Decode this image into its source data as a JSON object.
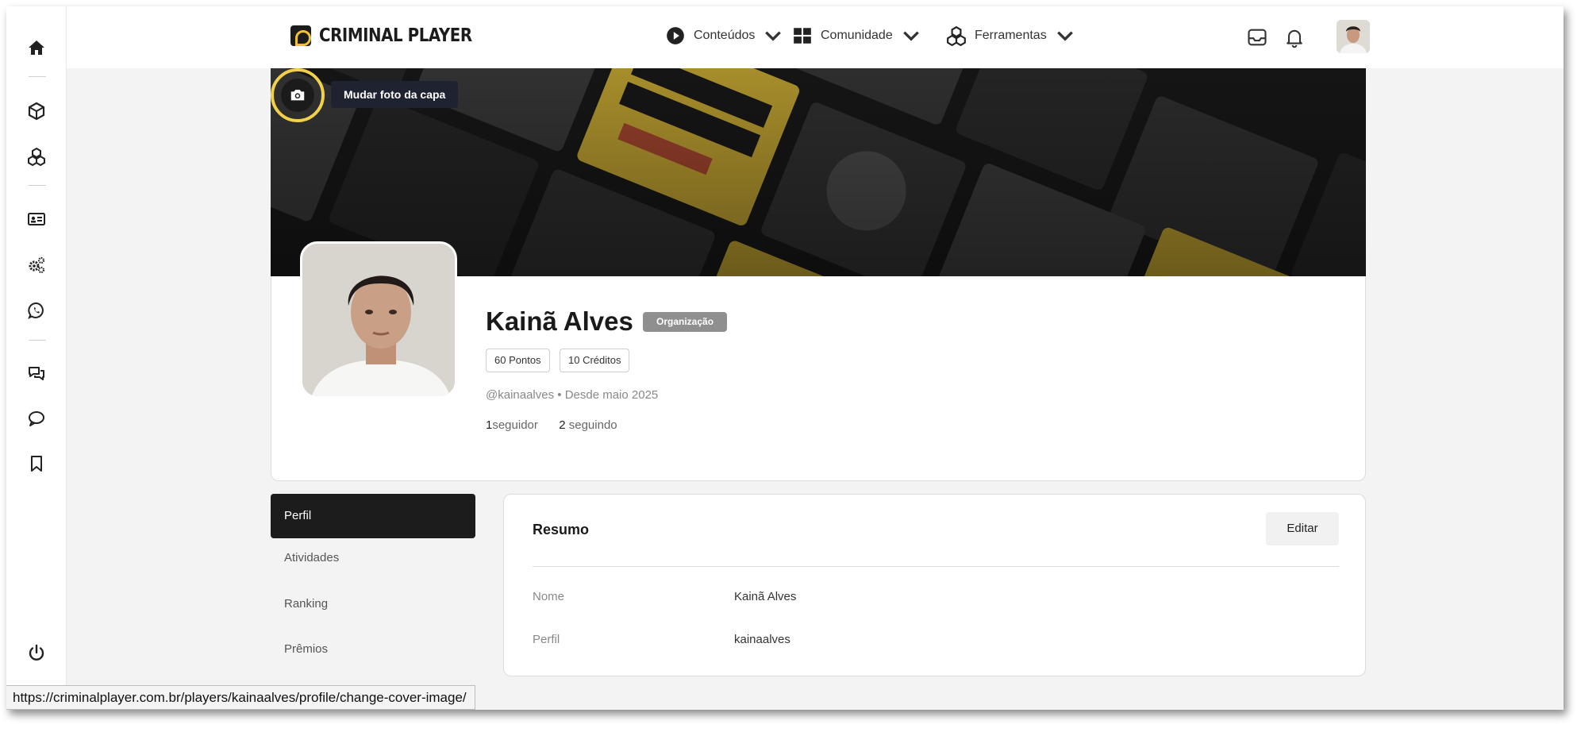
{
  "brand": {
    "name": "CRIMINAL PLAYER",
    "accent": "#f2c230",
    "dark": "#1c1c1c"
  },
  "sidebar": {
    "icons": [
      "home-icon",
      "cube-icon",
      "cubes-icon",
      "id-card-icon",
      "gears-icon",
      "whatsapp-icon",
      "comments-icon",
      "comment-icon",
      "bookmark-icon",
      "power-icon"
    ]
  },
  "topnav": {
    "items": [
      {
        "label": "Conteúdos",
        "icon": "play-circle-icon"
      },
      {
        "label": "Comunidade",
        "icon": "grid-icon"
      },
      {
        "label": "Ferramentas",
        "icon": "cubes-icon"
      }
    ],
    "right_icons": [
      "inbox-icon",
      "bell-icon"
    ]
  },
  "cover": {
    "change_label": "Mudar foto da capa"
  },
  "profile": {
    "name": "Kainã Alves",
    "badge": "Organização",
    "points": "60 Pontos",
    "credits": "10 Créditos",
    "handle_line": "@kainaalves • Desde maio 2025",
    "followers_count": "1",
    "followers_label": "seguidor",
    "following_count": "2",
    "following_label": "seguindo"
  },
  "profile_menu": {
    "items": [
      "Perfil",
      "Atividades",
      "Ranking",
      "Prêmios"
    ],
    "active": "Perfil"
  },
  "summary": {
    "title": "Resumo",
    "edit_label": "Editar",
    "rows": [
      {
        "label": "Nome",
        "value": "Kainã Alves"
      },
      {
        "label": "Perfil",
        "value": "kainaalves"
      }
    ]
  },
  "status_url": "https://criminalplayer.com.br/players/kainaalves/profile/change-cover-image/"
}
